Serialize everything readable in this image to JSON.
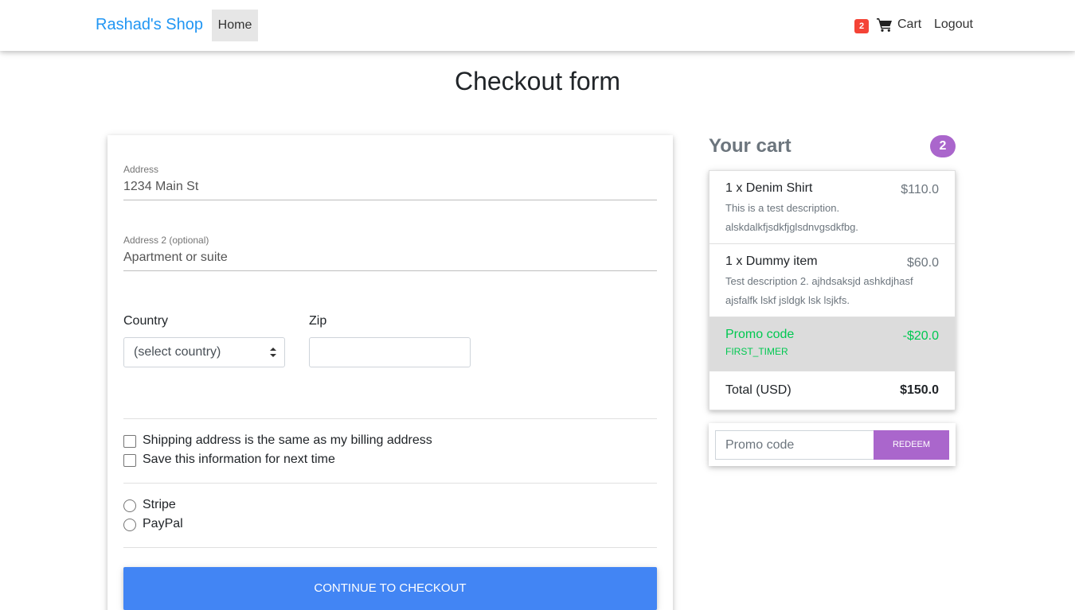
{
  "navbar": {
    "brand": "Rashad's Shop",
    "home_label": "Home",
    "cart_badge": "2",
    "cart_label": "Cart",
    "logout_label": "Logout"
  },
  "page": {
    "title": "Checkout form"
  },
  "form": {
    "address": {
      "label": "Address",
      "placeholder": "1234 Main St"
    },
    "address2": {
      "label": "Address 2 (optional)",
      "placeholder": "Apartment or suite"
    },
    "country": {
      "label": "Country",
      "selected": "(select country)"
    },
    "zip": {
      "label": "Zip",
      "value": ""
    },
    "checkboxes": [
      {
        "label": "Shipping address is the same as my billing address",
        "checked": false
      },
      {
        "label": "Save this information for next time",
        "checked": false
      }
    ],
    "payment_methods": [
      {
        "label": "Stripe",
        "selected": false
      },
      {
        "label": "PayPal",
        "selected": false
      }
    ],
    "submit_label": "CONTINUE TO CHECKOUT"
  },
  "cart": {
    "heading": "Your cart",
    "count": "2",
    "items": [
      {
        "name": "1 x Denim Shirt",
        "price": "$110.0",
        "description": "This is a test description. alskdalkfjsdkfjglsdnvgsdkfbg."
      },
      {
        "name": "1 x Dummy item",
        "price": "$60.0",
        "description": "Test description 2. ajhdsaksjd ashkdjhasf ajsfalfk lskf jsldgk lsk lsjkfs."
      }
    ],
    "promo": {
      "label": "Promo code",
      "code": "FIRST_TIMER",
      "amount": "-$20.0"
    },
    "total": {
      "label": "Total (USD)",
      "value": "$150.0"
    },
    "redeem": {
      "placeholder": "Promo code",
      "button_label": "REDEEM"
    }
  },
  "colors": {
    "brand": "#2196f3",
    "primary_button": "#4285f4",
    "secondary": "#aa66cc",
    "success": "#00c851",
    "badge": "#f44336"
  }
}
